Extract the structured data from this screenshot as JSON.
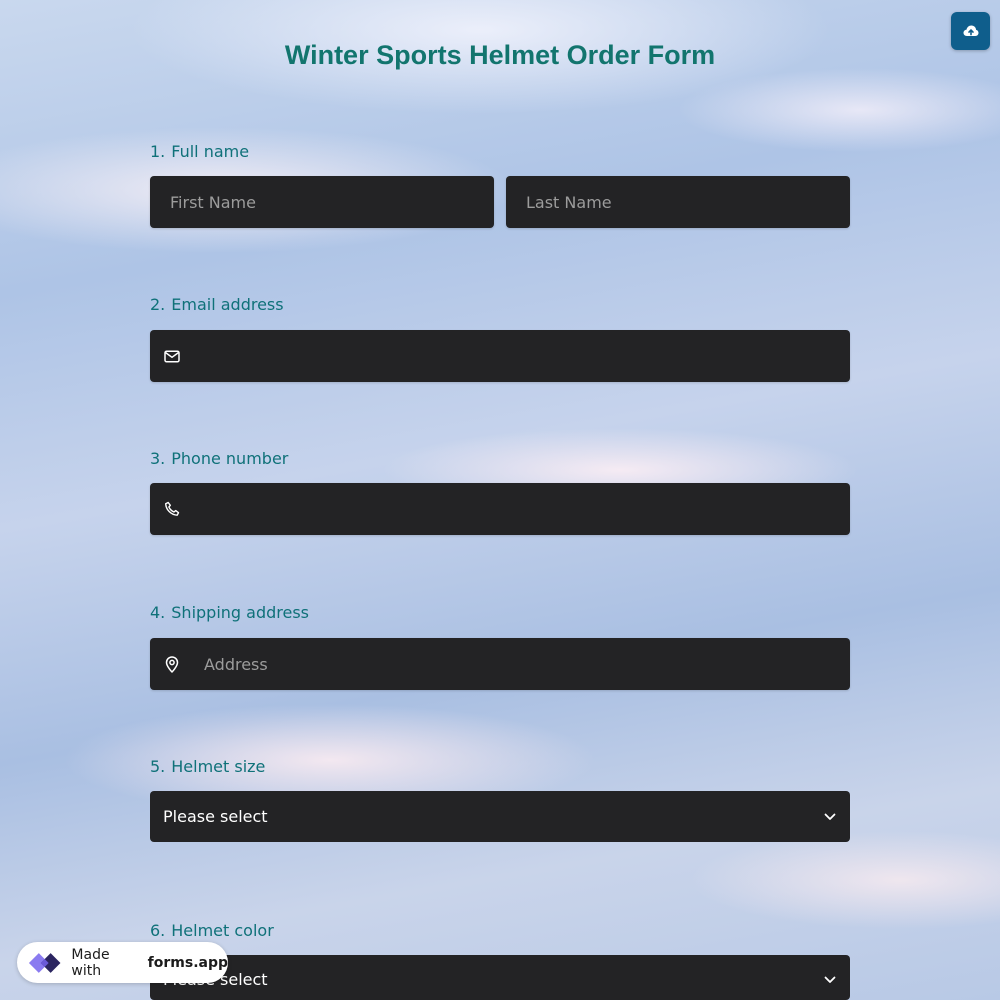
{
  "form": {
    "title": "Winter Sports Helmet Order Form"
  },
  "upload_icon": "cloud-upload-icon",
  "questions": [
    {
      "number": "1.",
      "label": "Full name",
      "first_name_placeholder": "First Name",
      "last_name_placeholder": "Last Name"
    },
    {
      "number": "2.",
      "label": "Email address",
      "icon": "envelope-icon",
      "value": ""
    },
    {
      "number": "3.",
      "label": "Phone number",
      "icon": "phone-icon",
      "value": ""
    },
    {
      "number": "4.",
      "label": "Shipping address",
      "icon": "map-pin-icon",
      "placeholder": "Address"
    },
    {
      "number": "5.",
      "label": "Helmet size",
      "selected": "Please select"
    },
    {
      "number": "6.",
      "label": "Helmet color",
      "selected": "Please select"
    }
  ],
  "badge": {
    "prefix": "Made with",
    "brand": "forms.app"
  },
  "colors": {
    "title": "#12756e",
    "label": "#0f7179",
    "field_bg": "#232325",
    "upload_button": "#0f5e8c"
  }
}
